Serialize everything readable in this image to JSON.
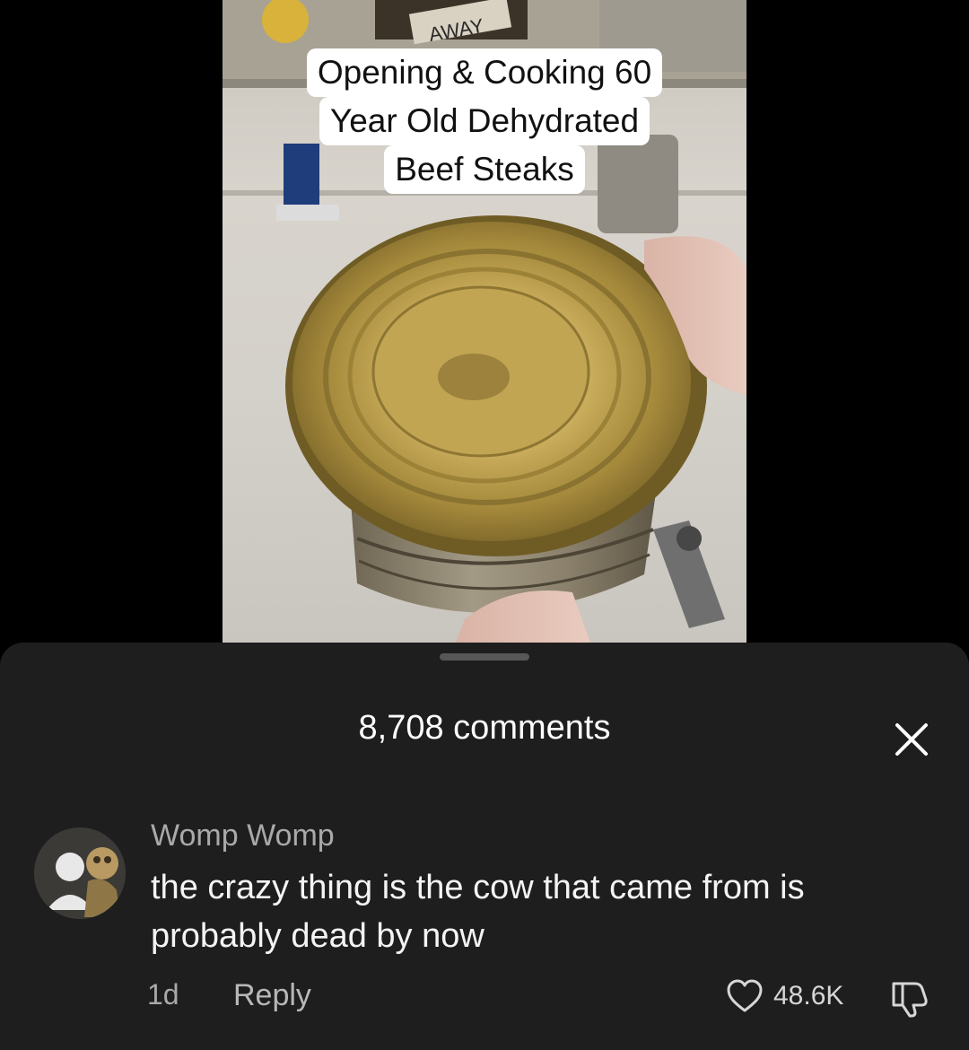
{
  "video": {
    "caption_lines": [
      "Opening & Cooking 60",
      "Year Old Dehydrated",
      "Beef Steaks"
    ],
    "sign_text": "AWAY"
  },
  "comments_panel": {
    "count_label": "8,708 comments",
    "close_icon": "close-icon"
  },
  "comment": {
    "author": "Womp Womp",
    "text": "the crazy thing is the cow that came from is probably dead by now",
    "time": "1d",
    "reply_label": "Reply",
    "like_count": "48.6K",
    "like_icon": "heart-outline-icon",
    "dislike_icon": "thumbs-down-icon"
  },
  "colors": {
    "sheet_bg": "#1e1e1e",
    "text_primary": "#f4f4f4",
    "text_secondary": "#a9a9a9"
  }
}
